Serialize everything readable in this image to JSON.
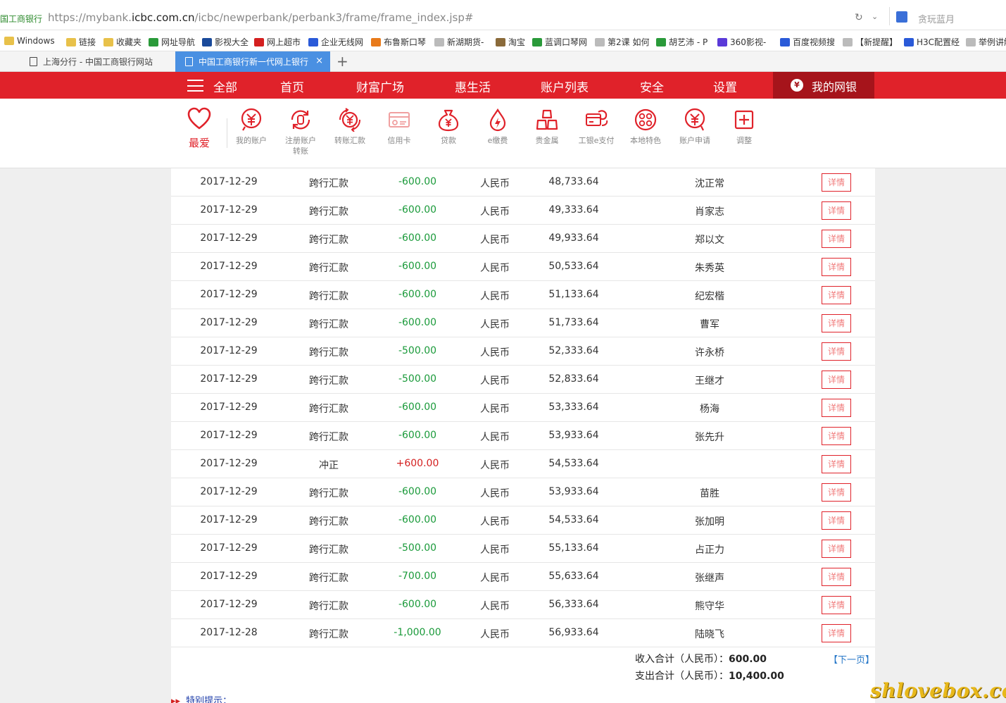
{
  "browser": {
    "site_label": "国工商银行",
    "url_prefix": "https://mybank.",
    "url_domain": "icbc.com.cn",
    "url_path": "/icbc/newperbank/perbank3/frame/frame_index.jsp#",
    "search_placeholder": "贪玩蓝月"
  },
  "bookmarks": [
    {
      "label": "Windows",
      "color": "#e8c14a"
    },
    {
      "label": "链接",
      "color": "#e8c14a"
    },
    {
      "label": "收藏夹",
      "color": "#e8c14a"
    },
    {
      "label": "网址导航",
      "color": "#2a9a3a"
    },
    {
      "label": "影视大全",
      "color": "#1a4a9a"
    },
    {
      "label": "网上超市",
      "color": "#d42020"
    },
    {
      "label": "企业无线网",
      "color": "#2a5ad8"
    },
    {
      "label": "布鲁斯口琴",
      "color": "#e87a1a"
    },
    {
      "label": "新湖期货-",
      "color": "#bbbbbb"
    },
    {
      "label": "淘宝",
      "color": "#8a6a3a"
    },
    {
      "label": "蓝调口琴网",
      "color": "#2a9a3a"
    },
    {
      "label": "第2课 如何",
      "color": "#bbbbbb"
    },
    {
      "label": "胡艺沛 - P",
      "color": "#2a9a3a"
    },
    {
      "label": "360影视-",
      "color": "#5a3ad8"
    },
    {
      "label": "百度视频搜",
      "color": "#2a5ad8"
    },
    {
      "label": "【新提醒】",
      "color": "#bbbbbb"
    },
    {
      "label": "H3C配置经",
      "color": "#2a5ad8"
    },
    {
      "label": "举例讲解",
      "color": "#bbbbbb"
    }
  ],
  "tabs": [
    {
      "label": "上海分行 - 中国工商银行网站"
    },
    {
      "label": "中国工商银行新一代网上银行",
      "close": "×"
    }
  ],
  "new_tab": "+",
  "nav": {
    "all": "全部",
    "home": "首页",
    "wealth": "财富广场",
    "life": "惠生活",
    "accounts": "账户列表",
    "security": "安全",
    "settings": "设置",
    "my_bank": "我的网银"
  },
  "toolbar": {
    "favorite": "最爱",
    "items": [
      {
        "label": "我的账户",
        "icon": "yuan-circle-icon"
      },
      {
        "label": "注册账户转账",
        "icon": "transfer-refresh-icon"
      },
      {
        "label": "转账汇款",
        "icon": "yuan-arrows-icon"
      },
      {
        "label": "信用卡",
        "icon": "credit-card-icon"
      },
      {
        "label": "贷款",
        "icon": "money-bag-icon"
      },
      {
        "label": "e缴费",
        "icon": "flame-drop-icon"
      },
      {
        "label": "贵金属",
        "icon": "gold-bars-icon"
      },
      {
        "label": "工银e支付",
        "icon": "epay-card-icon"
      },
      {
        "label": "本地特色",
        "icon": "grid-dots-icon"
      },
      {
        "label": "账户申请",
        "icon": "yuan-chat-icon"
      },
      {
        "label": "调整",
        "icon": "plus-square-icon"
      }
    ]
  },
  "detail_label": "详情",
  "transactions": [
    {
      "date": "2017-12-29",
      "type": "跨行汇款",
      "amount": "-600.00",
      "currency": "人民币",
      "balance": "48,733.64",
      "name": "沈正常"
    },
    {
      "date": "2017-12-29",
      "type": "跨行汇款",
      "amount": "-600.00",
      "currency": "人民币",
      "balance": "49,333.64",
      "name": "肖家志"
    },
    {
      "date": "2017-12-29",
      "type": "跨行汇款",
      "amount": "-600.00",
      "currency": "人民币",
      "balance": "49,933.64",
      "name": "郑以文"
    },
    {
      "date": "2017-12-29",
      "type": "跨行汇款",
      "amount": "-600.00",
      "currency": "人民币",
      "balance": "50,533.64",
      "name": "朱秀英"
    },
    {
      "date": "2017-12-29",
      "type": "跨行汇款",
      "amount": "-600.00",
      "currency": "人民币",
      "balance": "51,133.64",
      "name": "纪宏楷"
    },
    {
      "date": "2017-12-29",
      "type": "跨行汇款",
      "amount": "-600.00",
      "currency": "人民币",
      "balance": "51,733.64",
      "name": "曹军"
    },
    {
      "date": "2017-12-29",
      "type": "跨行汇款",
      "amount": "-500.00",
      "currency": "人民币",
      "balance": "52,333.64",
      "name": "许永桥"
    },
    {
      "date": "2017-12-29",
      "type": "跨行汇款",
      "amount": "-500.00",
      "currency": "人民币",
      "balance": "52,833.64",
      "name": "王继才"
    },
    {
      "date": "2017-12-29",
      "type": "跨行汇款",
      "amount": "-600.00",
      "currency": "人民币",
      "balance": "53,333.64",
      "name": "杨海"
    },
    {
      "date": "2017-12-29",
      "type": "跨行汇款",
      "amount": "-600.00",
      "currency": "人民币",
      "balance": "53,933.64",
      "name": "张先升"
    },
    {
      "date": "2017-12-29",
      "type": "冲正",
      "amount": "+600.00",
      "currency": "人民币",
      "balance": "54,533.64",
      "name": ""
    },
    {
      "date": "2017-12-29",
      "type": "跨行汇款",
      "amount": "-600.00",
      "currency": "人民币",
      "balance": "53,933.64",
      "name": "苗胜"
    },
    {
      "date": "2017-12-29",
      "type": "跨行汇款",
      "amount": "-600.00",
      "currency": "人民币",
      "balance": "54,533.64",
      "name": "张加明"
    },
    {
      "date": "2017-12-29",
      "type": "跨行汇款",
      "amount": "-500.00",
      "currency": "人民币",
      "balance": "55,133.64",
      "name": "占正力"
    },
    {
      "date": "2017-12-29",
      "type": "跨行汇款",
      "amount": "-700.00",
      "currency": "人民币",
      "balance": "55,633.64",
      "name": "张继声"
    },
    {
      "date": "2017-12-29",
      "type": "跨行汇款",
      "amount": "-600.00",
      "currency": "人民币",
      "balance": "56,333.64",
      "name": "熊守华"
    },
    {
      "date": "2017-12-28",
      "type": "跨行汇款",
      "amount": "-1,000.00",
      "currency": "人民币",
      "balance": "56,933.64",
      "name": "陆晓飞"
    }
  ],
  "summary": {
    "income_label": "收入合计（人民币）：",
    "income_value": "600.00",
    "expense_label": "支出合计（人民币）：",
    "expense_value": "10,400.00",
    "next_page": "【下一页】"
  },
  "tip": "特别提示：",
  "watermark": "shlovebox.com",
  "colors": {
    "icbc_red": "#e0222a",
    "negative_amount": "#1a9a3a",
    "positive_amount": "#d42020",
    "active_tab": "#4a90e2"
  }
}
